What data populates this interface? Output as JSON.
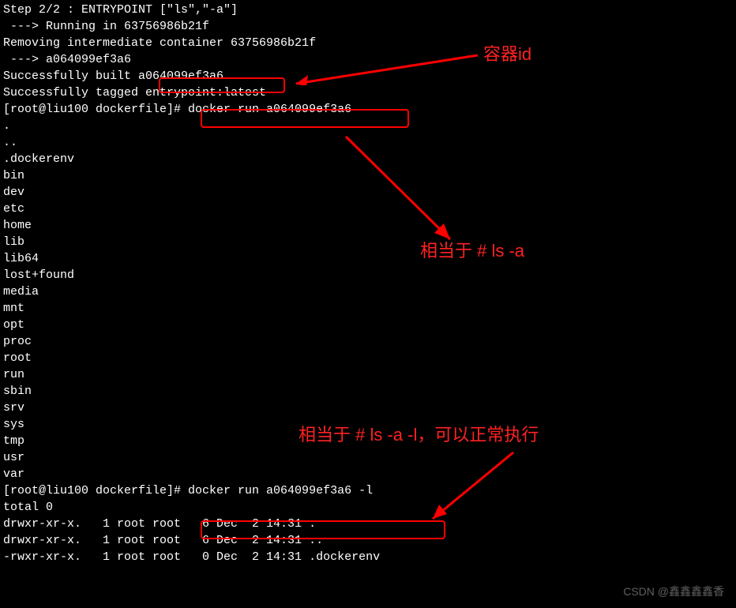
{
  "terminal": {
    "lines": [
      "Step 2/2 : ENTRYPOINT [\"ls\",\"-a\"]",
      " ---> Running in 63756986b21f",
      "Removing intermediate container 63756986b21f",
      " ---> a064099ef3a6",
      "Successfully built a064099ef3a6",
      "Successfully tagged entrypoint:latest",
      "[root@liu100 dockerfile]# docker run a064099ef3a6 ",
      "",
      ".",
      "..",
      ".dockerenv",
      "bin",
      "dev",
      "etc",
      "home",
      "lib",
      "lib64",
      "lost+found",
      "media",
      "mnt",
      "opt",
      "proc",
      "root",
      "run",
      "sbin",
      "srv",
      "sys",
      "tmp",
      "usr",
      "var",
      "[root@liu100 dockerfile]# docker run a064099ef3a6 -l",
      "total 0",
      "drwxr-xr-x.   1 root root   6 Dec  2 14:31 .",
      "drwxr-xr-x.   1 root root   6 Dec  2 14:31 ..",
      "-rwxr-xr-x.   1 root root   0 Dec  2 14:31 .dockerenv"
    ]
  },
  "annotations": {
    "container_id": "容器id",
    "ls_a": "相当于 # ls -a",
    "ls_a_l": "相当于 # ls -a -l，可以正常执行"
  },
  "watermark": "CSDN @鑫鑫鑫鑫香"
}
